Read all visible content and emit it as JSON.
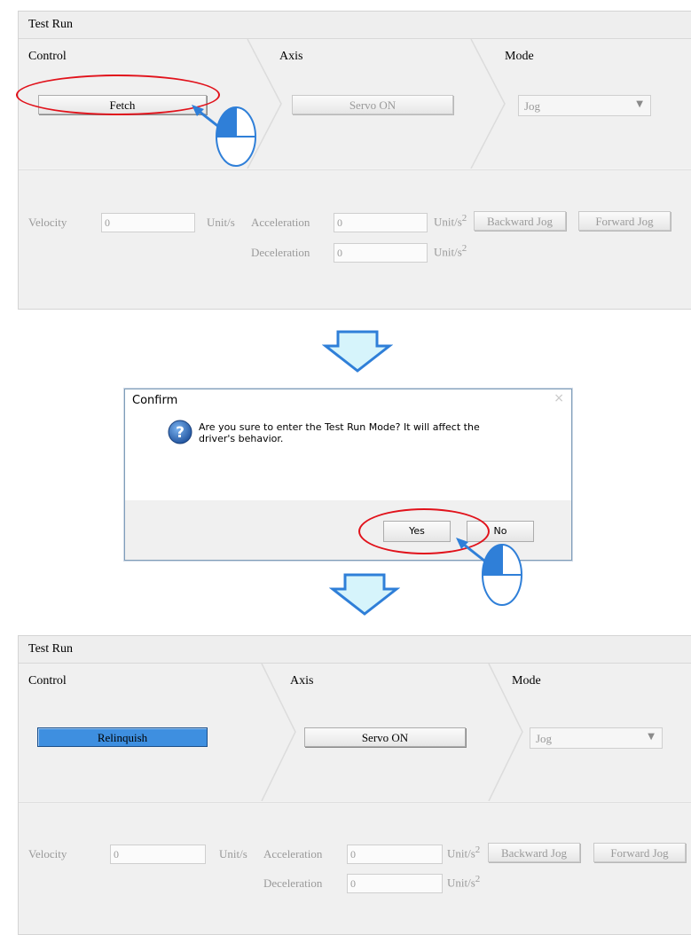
{
  "panel_before": {
    "title": "Test Run",
    "steps": {
      "control": "Control",
      "axis": "Axis",
      "mode": "Mode"
    },
    "fetch_button": "Fetch",
    "servo_button": "Servo ON",
    "mode_select": {
      "selected": "Jog"
    },
    "velocity": {
      "label": "Velocity",
      "value": "0",
      "unit": "Unit/s"
    },
    "acceleration": {
      "label": "Acceleration",
      "value": "0",
      "unit": "Unit/s",
      "unit_exp": "2"
    },
    "deceleration": {
      "label": "Deceleration",
      "value": "0",
      "unit": "Unit/s",
      "unit_exp": "2"
    },
    "backward_jog": "Backward Jog",
    "forward_jog": "Forward Jog"
  },
  "dialog": {
    "title": "Confirm",
    "close": "×",
    "message_line1": "Are you sure to enter the Test Run Mode? It will affect the",
    "message_line2": "driver's behavior.",
    "icon": "question-icon",
    "yes": "Yes",
    "no": "No"
  },
  "panel_after": {
    "title": "Test Run",
    "steps": {
      "control": "Control",
      "axis": "Axis",
      "mode": "Mode"
    },
    "relinquish_button": "Relinquish",
    "servo_button": "Servo ON",
    "mode_select": {
      "selected": "Jog"
    },
    "velocity": {
      "label": "Velocity",
      "value": "0",
      "unit": "Unit/s"
    },
    "acceleration": {
      "label": "Acceleration",
      "value": "0",
      "unit": "Unit/s",
      "unit_exp": "2"
    },
    "deceleration": {
      "label": "Deceleration",
      "value": "0",
      "unit": "Unit/s",
      "unit_exp": "2"
    },
    "backward_jog": "Backward Jog",
    "forward_jog": "Forward Jog"
  },
  "colors": {
    "highlight_ring": "#e1121b",
    "flow_arrow": "#2f7fd8",
    "flow_arrow_fill": "#d6f4fb",
    "active_button": "#3e8fe0"
  }
}
